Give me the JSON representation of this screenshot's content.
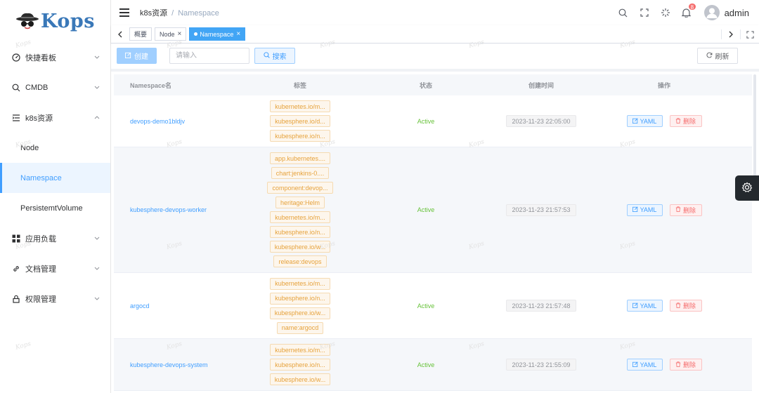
{
  "brand": {
    "logo_text": "Kops"
  },
  "sidebar": {
    "items": [
      {
        "label": "快捷看板",
        "icon": "dashboard-icon"
      },
      {
        "label": "CMDB",
        "icon": "search-icon"
      },
      {
        "label": "k8s资源",
        "icon": "list-icon",
        "expanded": true,
        "children": [
          {
            "label": "Node"
          },
          {
            "label": "Namespace",
            "active": true
          },
          {
            "label": "PersistemtVolume"
          }
        ]
      },
      {
        "label": "应用负载",
        "icon": "grid-icon"
      },
      {
        "label": "文档管理",
        "icon": "link-icon"
      },
      {
        "label": "权限管理",
        "icon": "lock-icon"
      }
    ]
  },
  "header": {
    "breadcrumb": {
      "parent": "k8s资源",
      "current": "Namespace"
    },
    "notification_count": "8",
    "username": "admin"
  },
  "tags": [
    {
      "label": "概要",
      "closable": false
    },
    {
      "label": "Node",
      "closable": true
    },
    {
      "label": "Namespace",
      "closable": true,
      "active": true
    }
  ],
  "toolbar": {
    "create_label": "创建",
    "search_placeholder": "请输入",
    "search_label": "搜索",
    "refresh_label": "刷新"
  },
  "table": {
    "columns": [
      "Namespace名",
      "标签",
      "状态",
      "创建时间",
      "操作"
    ],
    "yaml_label": "YAML",
    "delete_label": "删除",
    "rows": [
      {
        "name": "devops-demo1bldjv",
        "labels": [
          "kubernetes.io/m...",
          "kubesphere.io/d...",
          "kubesphere.io/n..."
        ],
        "status": "Active",
        "created": "2023-11-23 22:05:00"
      },
      {
        "name": "kubesphere-devops-worker",
        "labels": [
          "app.kubernetes....",
          "chart:jenkins-0....",
          "component:devop...",
          "heritage:Helm",
          "kubernetes.io/m...",
          "kubesphere.io/n...",
          "kubesphere.io/w...",
          "release:devops"
        ],
        "status": "Active",
        "created": "2023-11-23 21:57:53"
      },
      {
        "name": "argocd",
        "labels": [
          "kubernetes.io/m...",
          "kubesphere.io/n...",
          "kubesphere.io/w...",
          "name:argocd"
        ],
        "status": "Active",
        "created": "2023-11-23 21:57:48"
      },
      {
        "name": "kubesphere-devops-system",
        "labels": [
          "kubernetes.io/m...",
          "kubesphere.io/n...",
          "kubesphere.io/w..."
        ],
        "status": "Active",
        "created": "2023-11-23 21:55:09"
      }
    ]
  },
  "watermark": "Kops"
}
